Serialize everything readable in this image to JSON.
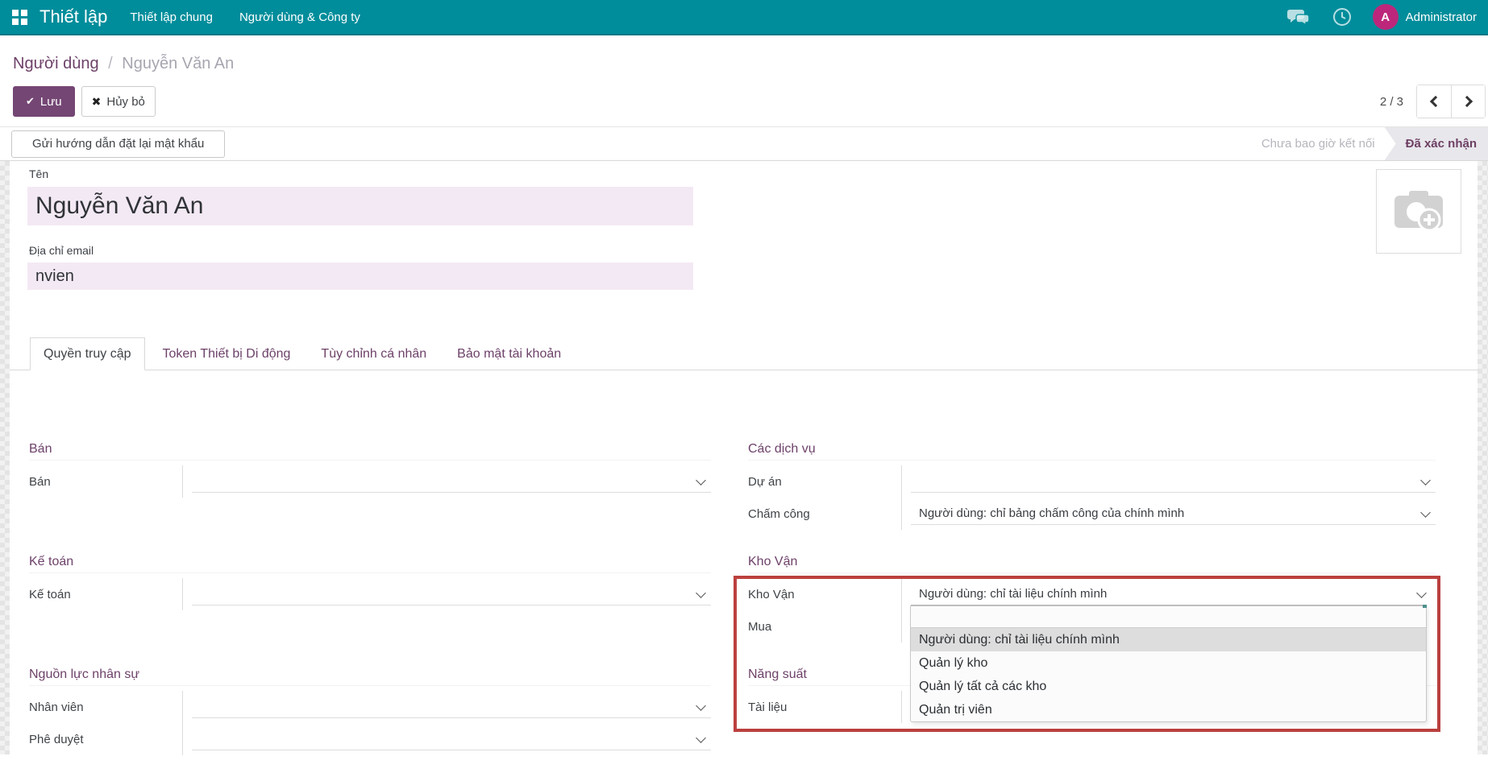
{
  "topbar": {
    "app_name": "Thiết lập",
    "menu": [
      "Thiết lập chung",
      "Người dùng & Công ty"
    ],
    "user_name": "Administrator",
    "avatar_initial": "A"
  },
  "breadcrumb": {
    "parent": "Người dùng",
    "separator": "/",
    "current": "Nguyễn Văn An"
  },
  "actions": {
    "save": "Lưu",
    "discard": "Hủy bỏ"
  },
  "pager": {
    "text": "2 / 3"
  },
  "statusbar": {
    "action_button": "Gửi hướng dẫn đặt lại mật khẩu",
    "state_inactive": "Chưa bao giờ kết nối",
    "state_active": "Đã xác nhận"
  },
  "form": {
    "name_label": "Tên",
    "name_value": "Nguyễn Văn An",
    "email_label": "Địa chỉ email",
    "email_value": "nvien"
  },
  "tabs": [
    {
      "label": "Quyền truy cập",
      "active": true
    },
    {
      "label": "Token Thiết bị Di động",
      "active": false
    },
    {
      "label": "Tùy chỉnh cá nhân",
      "active": false
    },
    {
      "label": "Bảo mật tài khoản",
      "active": false
    }
  ],
  "groups": {
    "left": [
      {
        "title": "Bán",
        "rows": [
          {
            "label": "Bán",
            "value": ""
          }
        ]
      },
      {
        "title": "Kế toán",
        "rows": [
          {
            "label": "Kế toán",
            "value": ""
          }
        ]
      },
      {
        "title": "Nguồn lực nhân sự",
        "rows": [
          {
            "label": "Nhân viên",
            "value": ""
          },
          {
            "label": "Phê duyệt",
            "value": ""
          }
        ]
      }
    ],
    "right": [
      {
        "title": "Các dịch vụ",
        "rows": [
          {
            "label": "Dự án",
            "value": ""
          },
          {
            "label": "Chấm công",
            "value": "Người dùng: chỉ bảng chấm công của chính mình"
          }
        ]
      },
      {
        "title": "Kho Vận",
        "rows": [
          {
            "label": "Kho Vận",
            "value": "Người dùng: chỉ tài liệu chính mình",
            "open": true,
            "covered": true
          },
          {
            "label": "Mua",
            "value": "",
            "covered": true
          }
        ]
      },
      {
        "title": "Năng suất",
        "rows": [
          {
            "label": "Tài liệu",
            "value": "",
            "covered": true
          }
        ]
      }
    ]
  },
  "dropdown": {
    "options": [
      "",
      "Người dùng: chỉ tài liệu chính mình",
      "Quản lý kho",
      "Quản lý tất cả các kho",
      "Quản trị viên"
    ],
    "selected_index": 1
  },
  "colors": {
    "topbar": "#008d9b",
    "accent": "#714674",
    "avatar": "#bc277b",
    "field_bg": "#f3e9f4",
    "dropdown_highlight": "#dddddd",
    "annotation_red": "#bb403e"
  }
}
